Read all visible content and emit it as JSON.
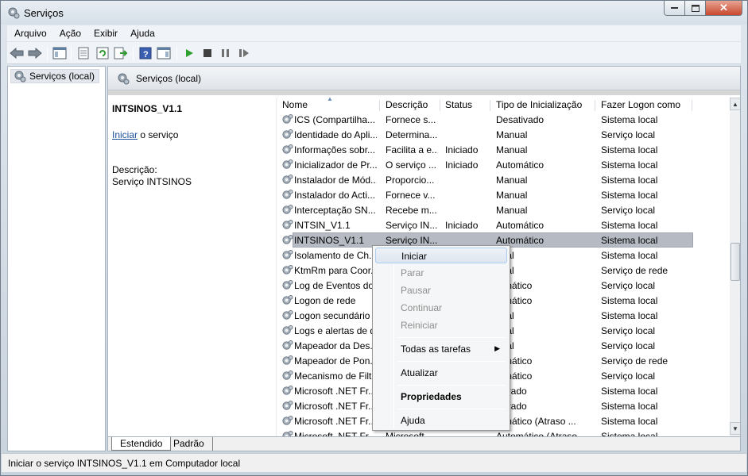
{
  "window": {
    "title": "Serviços"
  },
  "menu": {
    "items": [
      "Arquivo",
      "Ação",
      "Exibir",
      "Ajuda"
    ]
  },
  "tree": {
    "root_label": "Serviços (local)"
  },
  "main": {
    "header_title": "Serviços (local)"
  },
  "description_pane": {
    "service_name": "INTSINOS_V1.1",
    "action_link": "Iniciar",
    "action_suffix": " o serviço",
    "description_label": "Descrição:",
    "description_value": "Serviço INTSINOS"
  },
  "columns": [
    "Nome",
    "Descrição",
    "Status",
    "Tipo de Inicialização",
    "Fazer Logon como"
  ],
  "rows": [
    {
      "name": "ICS (Compartilha...",
      "desc": "Fornece s...",
      "status": "",
      "startup": "Desativado",
      "logon": "Sistema local"
    },
    {
      "name": "Identidade do Apli...",
      "desc": "Determina...",
      "status": "",
      "startup": "Manual",
      "logon": "Serviço local"
    },
    {
      "name": "Informações sobr...",
      "desc": "Facilita a e...",
      "status": "Iniciado",
      "startup": "Manual",
      "logon": "Sistema local"
    },
    {
      "name": "Inicializador de Pr...",
      "desc": "O serviço ...",
      "status": "Iniciado",
      "startup": "Automático",
      "logon": "Sistema local"
    },
    {
      "name": "Instalador de Mód...",
      "desc": "Proporcio...",
      "status": "",
      "startup": "Manual",
      "logon": "Sistema local"
    },
    {
      "name": "Instalador do Acti...",
      "desc": "Fornece v...",
      "status": "",
      "startup": "Manual",
      "logon": "Sistema local"
    },
    {
      "name": "Interceptação SN...",
      "desc": "Recebe m...",
      "status": "",
      "startup": "Manual",
      "logon": "Serviço local"
    },
    {
      "name": "INTSIN_V1.1",
      "desc": "Serviço IN...",
      "status": "Iniciado",
      "startup": "Automático",
      "logon": "Sistema local"
    },
    {
      "name": "INTSINOS_V1.1",
      "desc": "Serviço IN...",
      "status": "",
      "startup": "Automático",
      "logon": "Sistema local"
    },
    {
      "name": "Isolamento de Ch...",
      "desc": "",
      "status": "",
      "startup": "nual",
      "logon": "Sistema local"
    },
    {
      "name": "KtmRm para Coor...",
      "desc": "",
      "status": "",
      "startup": "nual",
      "logon": "Serviço de rede"
    },
    {
      "name": "Log de Eventos do",
      "desc": "",
      "status": "",
      "startup": "tomático",
      "logon": "Serviço local"
    },
    {
      "name": "Logon de rede",
      "desc": "",
      "status": "",
      "startup": "tomático",
      "logon": "Sistema local"
    },
    {
      "name": "Logon secundário",
      "desc": "",
      "status": "",
      "startup": "nual",
      "logon": "Sistema local"
    },
    {
      "name": "Logs e alertas de d",
      "desc": "",
      "status": "",
      "startup": "nual",
      "logon": "Serviço local"
    },
    {
      "name": "Mapeador da Des...",
      "desc": "",
      "status": "",
      "startup": "nual",
      "logon": "Serviço local"
    },
    {
      "name": "Mapeador de Pon...",
      "desc": "",
      "status": "",
      "startup": "tomático",
      "logon": "Serviço de rede"
    },
    {
      "name": "Mecanismo de Filt",
      "desc": "",
      "status": "",
      "startup": "tomático",
      "logon": "Serviço local"
    },
    {
      "name": "Microsoft .NET Fr...",
      "desc": "",
      "status": "",
      "startup": "ativado",
      "logon": "Sistema local"
    },
    {
      "name": "Microsoft .NET Fr...",
      "desc": "",
      "status": "",
      "startup": "ativado",
      "logon": "Sistema local"
    },
    {
      "name": "Microsoft .NET Fr...",
      "desc": "",
      "status": "",
      "startup": "tomático (Atraso ...",
      "logon": "Sistema local"
    },
    {
      "name": "Microsoft .NET Fr...",
      "desc": "Microsoft ...",
      "status": "",
      "startup": "Automático (Atraso ...",
      "logon": "Sistema local"
    }
  ],
  "context_menu": {
    "items": [
      {
        "label": "Iniciar"
      },
      {
        "label": "Parar"
      },
      {
        "label": "Pausar"
      },
      {
        "label": "Continuar"
      },
      {
        "label": "Reiniciar"
      },
      {
        "label": "Todas as tarefas"
      },
      {
        "label": "Atualizar"
      },
      {
        "label": "Propriedades"
      },
      {
        "label": "Ajuda"
      }
    ]
  },
  "tabs": [
    "Estendido",
    "Padrão"
  ],
  "status": {
    "text": "Iniciar o serviço INTSINOS_V1.1 em Computador local"
  },
  "colors": {
    "selection": "#b5bac3",
    "link": "#1b4e9b",
    "close_button": "#c8482e"
  }
}
